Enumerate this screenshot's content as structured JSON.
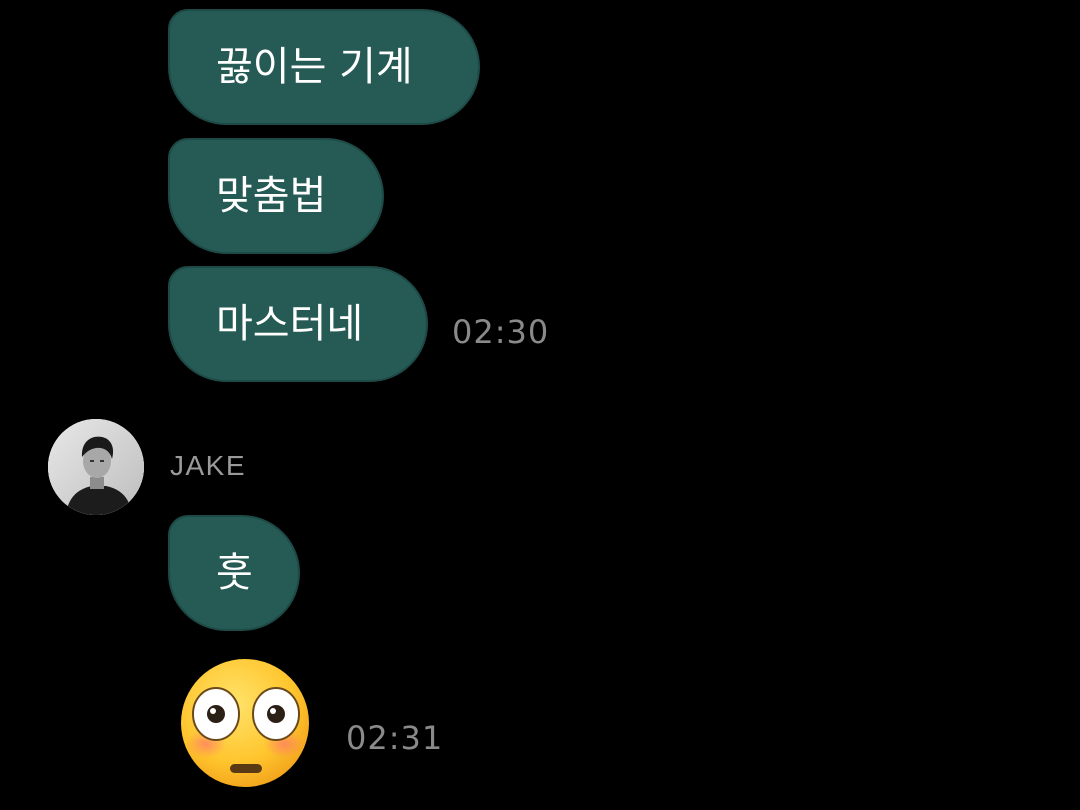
{
  "messages_outgoing": [
    {
      "text": "끓이는 기계"
    },
    {
      "text": "맞춤법"
    },
    {
      "text": "마스터네"
    }
  ],
  "timestamps": {
    "outgoing_last": "02:30",
    "incoming_last": "02:31"
  },
  "incoming": {
    "sender_name": "JAKE",
    "avatar_icon": "profile-photo",
    "messages": [
      {
        "text": "훗"
      }
    ],
    "sticker_icon": "flushed-face-emoji"
  },
  "colors": {
    "background": "#000000",
    "bubble": "#255a55",
    "timestamp": "#8a8a8a",
    "sender_name": "#9a9a9a"
  }
}
